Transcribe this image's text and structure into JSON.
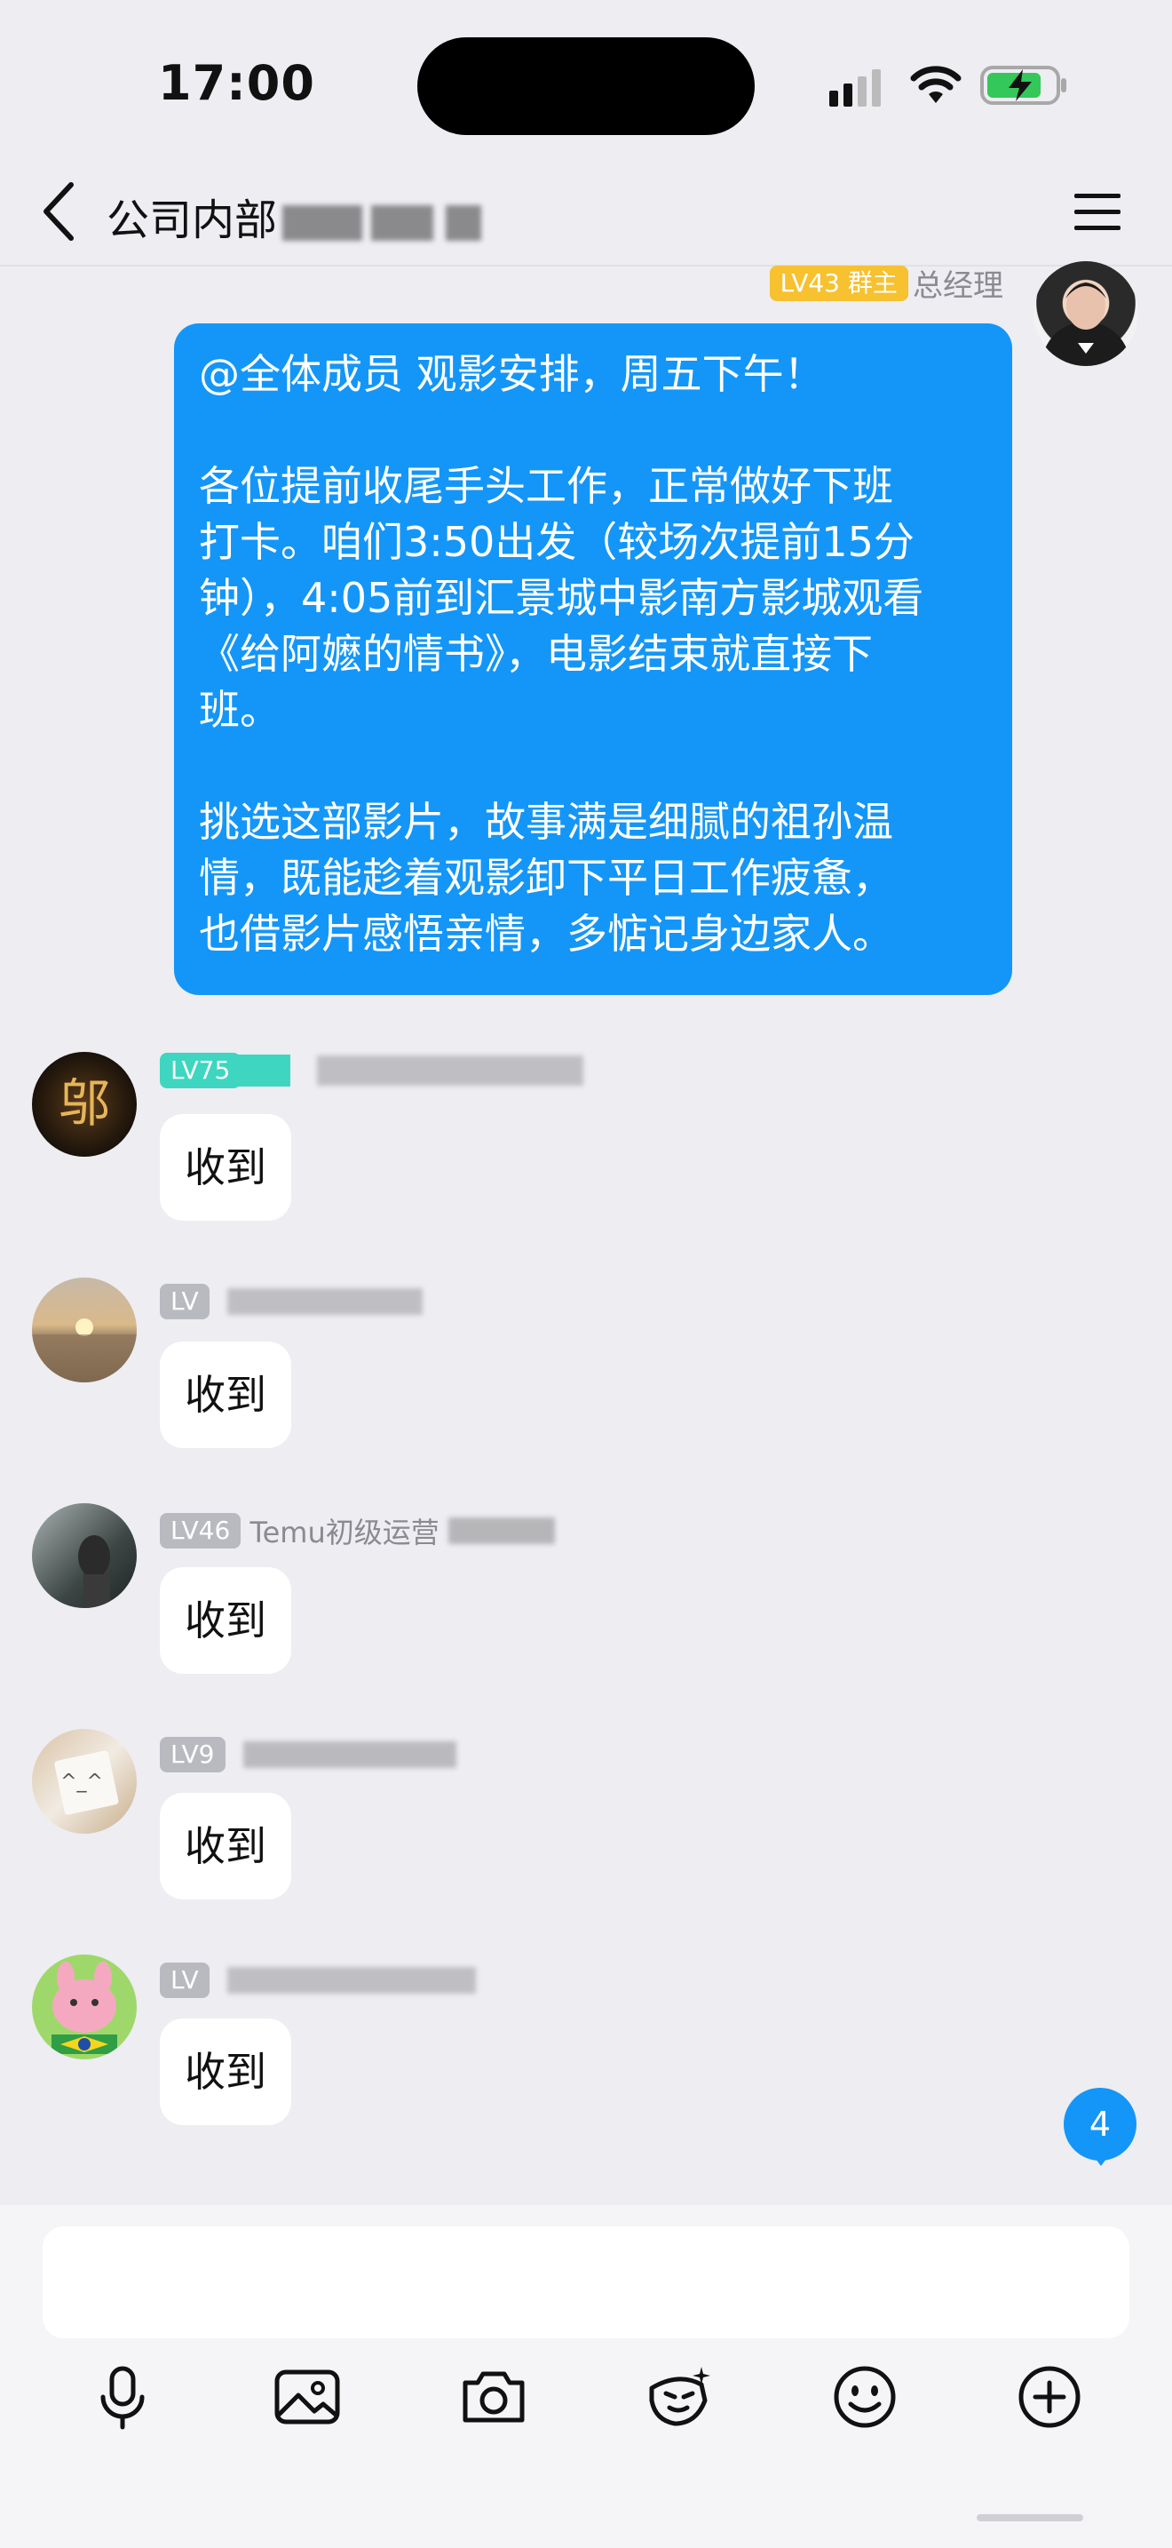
{
  "status_bar": {
    "time": "17:00"
  },
  "header": {
    "title": "公司内部"
  },
  "messages": {
    "owner": {
      "level": "LV43",
      "role": "群主",
      "name": "总经理",
      "lines": [
        "@全体成员 观影安排，周五下午！",
        "",
        "各位提前收尾手头工作，正常做好下班",
        "打卡。咱们3:50出发（较场次提前15分",
        "钟），4:05前到汇景城中影南方影城观看",
        "《给阿嬷的情书》，电影结束就直接下",
        "班。",
        "",
        "挑选这部影片，故事满是细腻的祖孙温",
        "情，既能趁着观影卸下平日工作疲惫，",
        "也借影片感悟亲情，多惦记身边家人。"
      ]
    },
    "replies": [
      {
        "level": "LV75",
        "name": "",
        "text": "收到"
      },
      {
        "level": "LV",
        "name": "",
        "text": "收到"
      },
      {
        "level": "LV46",
        "name": "Temu初级运营",
        "text": "收到"
      },
      {
        "level": "LV9",
        "name": "",
        "text": "收到"
      },
      {
        "level": "LV",
        "name": "",
        "text": "收到"
      }
    ]
  },
  "unread_count": "4",
  "input": {
    "placeholder": ""
  },
  "colors": {
    "accent": "#1496f8",
    "owner_badge": "#f7c12f",
    "level_badge_teal": "#3ed6c0",
    "level_badge_grey": "#b9b9c0",
    "background": "#ededf2"
  },
  "toolbar": {
    "icons": [
      "microphone-icon",
      "image-icon",
      "camera-icon",
      "sticker-icon",
      "emoji-icon",
      "add-icon"
    ]
  }
}
